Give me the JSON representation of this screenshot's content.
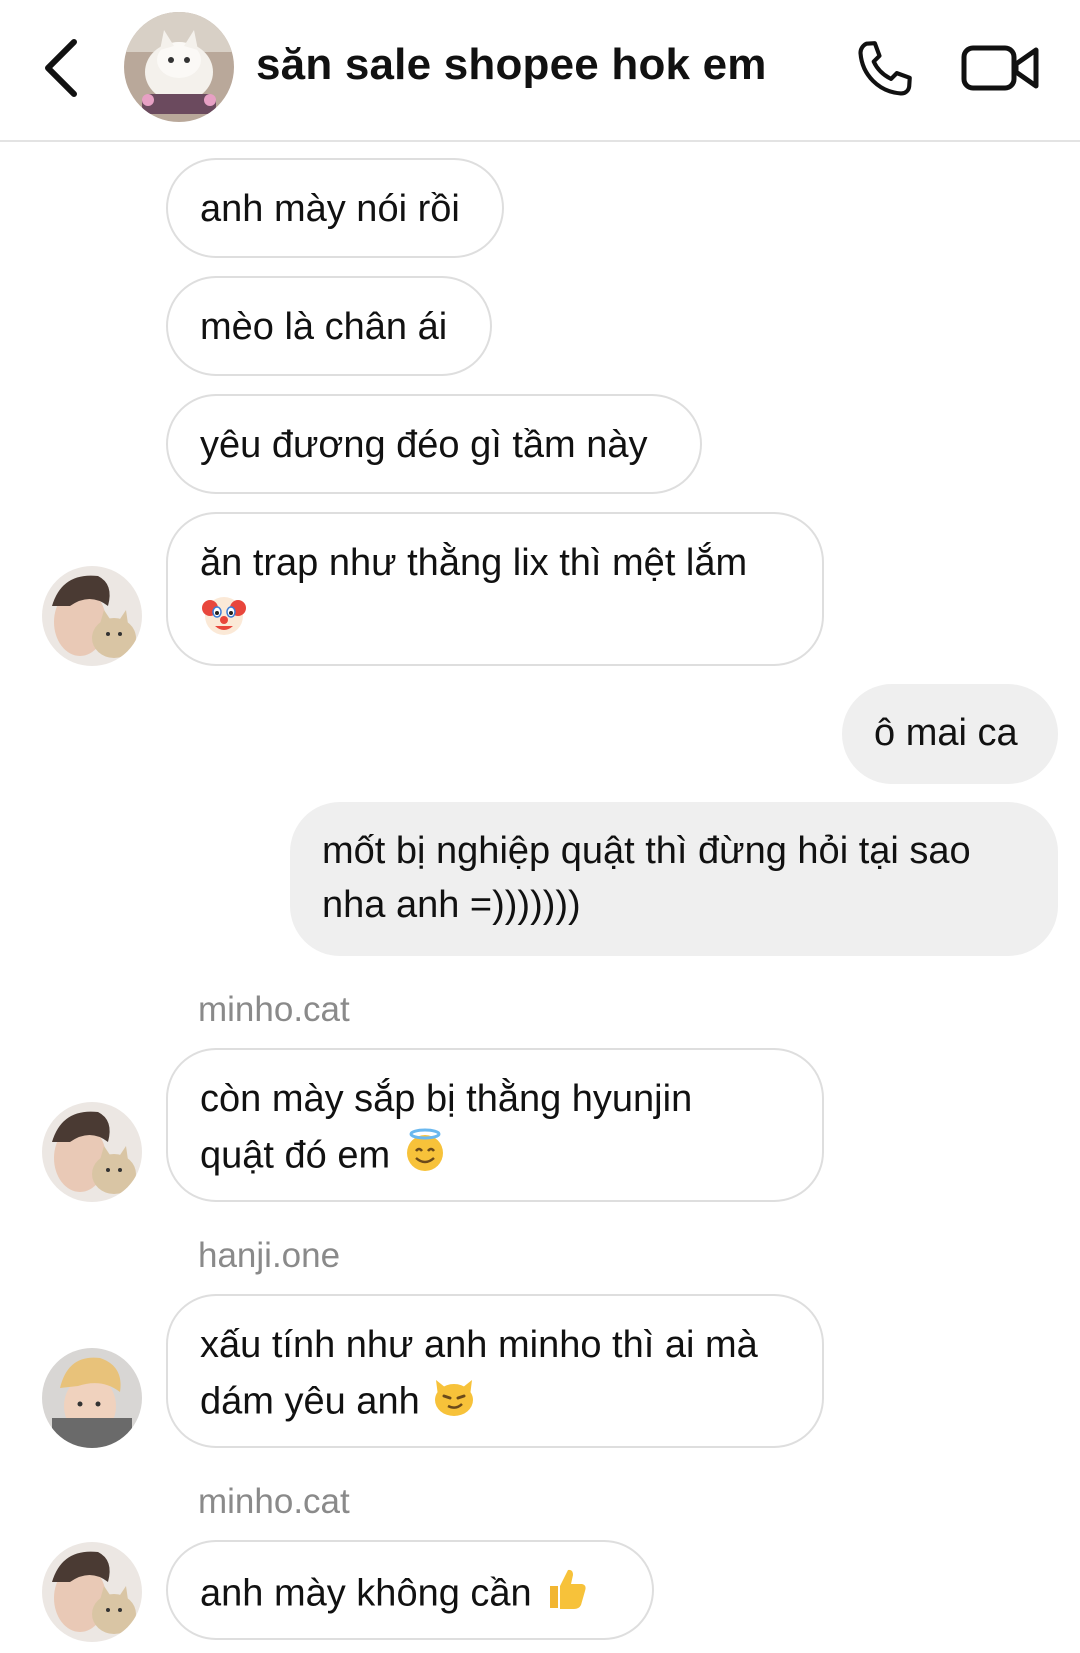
{
  "header": {
    "title": "săn sale shopee hok em",
    "back_icon": "chevron-left-icon",
    "call_icon": "phone-icon",
    "video_icon": "video-camera-icon",
    "group_avatar": "cat-photo"
  },
  "messages": [
    {
      "direction": "incoming",
      "text": "anh mày nói rồi"
    },
    {
      "direction": "incoming",
      "text": "mèo là chân ái"
    },
    {
      "direction": "incoming",
      "text": "yêu đương đéo gì tầm này"
    },
    {
      "direction": "incoming",
      "line1": "ăn trap như thằng lix thì mệt lắm",
      "emoji": "🤡",
      "emoji_icon": "clown-face-emoji"
    },
    {
      "direction": "outgoing",
      "text": "ô mai ca"
    },
    {
      "direction": "outgoing",
      "line1": "mốt bị nghiệp quật thì đừng hỏi tại sao",
      "line2": "nha anh =)))))))"
    },
    {
      "direction": "incoming",
      "sender": "minho.cat",
      "line1": "còn mày sắp bị thằng hyunjin",
      "line2": "quật đó em",
      "emoji": "😇",
      "emoji_icon": "smiling-halo-emoji"
    },
    {
      "direction": "incoming",
      "sender": "hanji.one",
      "line1": "xấu tính như anh minho thì ai mà",
      "line2": "dám yêu anh",
      "emoji": "😼",
      "emoji_icon": "smirking-cat-emoji"
    },
    {
      "direction": "incoming",
      "sender": "minho.cat",
      "line1": "anh mày không cần",
      "emoji": "👍",
      "emoji_icon": "thumbs-up-emoji"
    }
  ],
  "colors": {
    "incoming_border": "#dedede",
    "outgoing_bg": "#efefef",
    "sender_text": "#8a8a8a",
    "header_divider": "#e3e3e3"
  }
}
